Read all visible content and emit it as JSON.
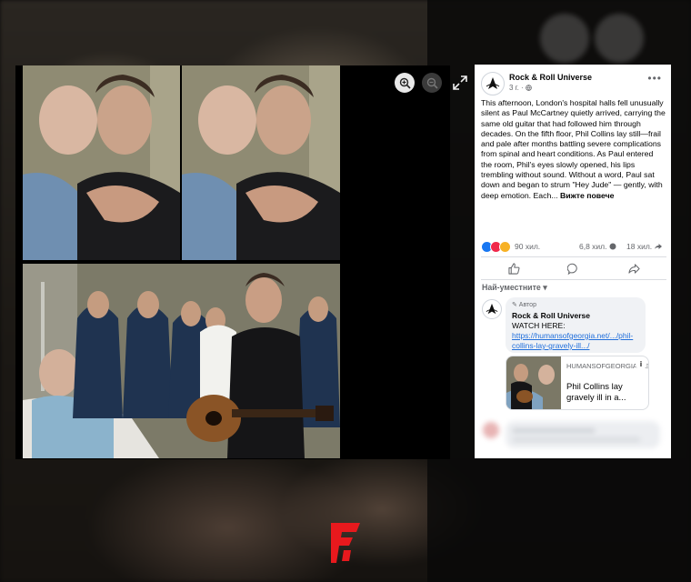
{
  "viewer": {
    "zoom_in_icon": "zoom-in-icon",
    "zoom_out_icon": "zoom-out-icon",
    "expand_icon": "expand-icon"
  },
  "post": {
    "page_name": "Rock & Roll Universe",
    "time": "3 г. ·",
    "privacy_icon": "globe-icon",
    "more_label": "•••",
    "text": "This afternoon, London's hospital halls fell unusually silent as Paul McCartney quietly arrived, carrying the same old guitar that had followed him through decades. On the fifth floor, Phil Collins lay still—frail and pale after months battling severe complications from spinal and heart conditions. As Paul entered the room, Phil's eyes slowly opened, his lips trembling without sound. Without a word, Paul sat down and began to strum \"Hey Jude\" — gently, with deep emotion. Each...",
    "see_more": "Вижте повече",
    "reactions_count": "90 хил.",
    "comments_count": "6,8 хил.",
    "shares_count": "18 хил.",
    "action_icons": [
      "like-icon",
      "comment-icon",
      "share-icon"
    ]
  },
  "comments": {
    "sort_label": "Най-уместните ▾",
    "first": {
      "author_badge": "✎ Автор",
      "author": "Rock & Roll Universe",
      "text": "WATCH HERE:",
      "link": "https://humansofgeorgia.net/.../phil-collins-lay-gravely-ill.../"
    },
    "preview": {
      "domain": "HUMANSOFGEORGIA.NET",
      "title": "Phil Collins lay gravely ill in a...",
      "info": "i"
    }
  },
  "colors": {
    "accent_link": "#216fdb",
    "watermark_red": "#e8191d",
    "card_bg": "#ffffff",
    "bubble_bg": "#f0f2f5"
  }
}
